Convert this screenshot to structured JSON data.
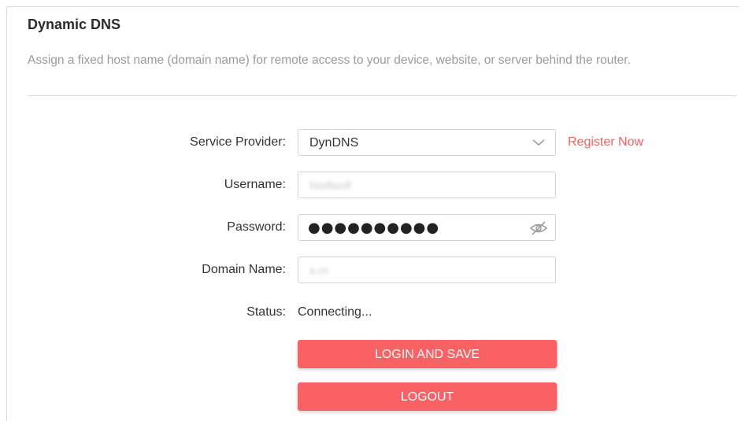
{
  "section": {
    "title": "Dynamic DNS",
    "description": "Assign a fixed host name (domain name) for remote access to your device, website, or server behind the router."
  },
  "form": {
    "service_provider": {
      "label": "Service Provider:",
      "value": "DynDNS",
      "link": "Register Now"
    },
    "username": {
      "label": "Username:",
      "value": "fasdfasdf"
    },
    "password": {
      "label": "Password:",
      "value": "●●●●●●●●●●"
    },
    "domain_name": {
      "label": "Domain Name:",
      "value": "a.cn"
    },
    "status": {
      "label": "Status:",
      "value": "Connecting..."
    }
  },
  "buttons": {
    "login_save": "LOGIN AND SAVE",
    "logout": "LOGOUT"
  },
  "colors": {
    "accent": "#fa6164",
    "link": "#f26663",
    "muted_text": "#9a9a9a"
  },
  "icons": {
    "dropdown": "chevron-down-icon",
    "password_toggle": "eye-slash-icon"
  }
}
